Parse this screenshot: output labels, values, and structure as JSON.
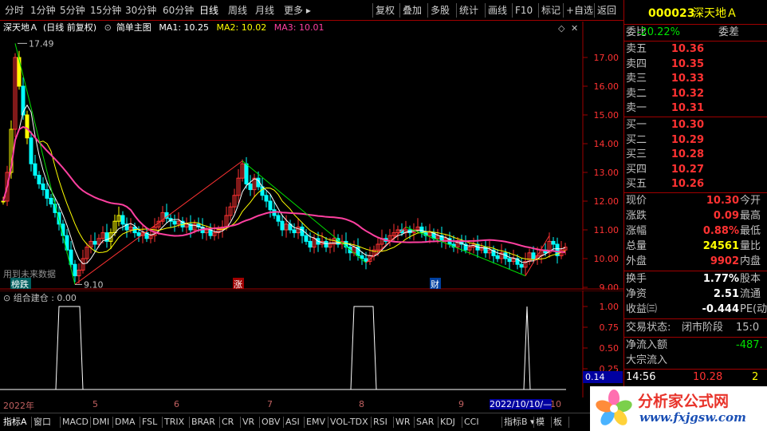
{
  "toolbar": {
    "periods": [
      "分时",
      "1分钟",
      "5分钟",
      "15分钟",
      "30分钟",
      "60分钟",
      "日线",
      "周线",
      "月线",
      "更多"
    ],
    "active_period": "日线",
    "tools": [
      "复权",
      "叠加",
      "多股",
      "统计",
      "画线",
      "F10",
      "标记",
      "+自选",
      "返回"
    ]
  },
  "main": {
    "stock_name": "深天地Ａ",
    "mode": "(日线 前复权)",
    "template_label": "简单主图",
    "ma1_label": "MA1: 10.25",
    "ma2_label": "MA2: 10.02",
    "ma3_label": "MA3: 10.01",
    "high_label": "17.49",
    "low_label": "9.10",
    "future_note": "用到未来数据",
    "event_tags": [
      "榜跌",
      "涨",
      "财"
    ],
    "y_ticks": [
      "17.00",
      "16.00",
      "15.00",
      "14.00",
      "13.00",
      "12.00",
      "11.00",
      "10.00",
      "9.00"
    ]
  },
  "sub": {
    "title": "组合建仓 : 0.00",
    "y_ticks": [
      "1.00",
      "0.75",
      "0.50",
      "0.25"
    ],
    "current_value": "0.14"
  },
  "date_axis": {
    "labels": [
      "2022年",
      "5",
      "6",
      "7",
      "8",
      "9",
      "2022/10/10/—",
      "10"
    ]
  },
  "tabs": [
    "指标A",
    "窗口",
    "MACD",
    "DMI",
    "DMA",
    "FSL",
    "TRIX",
    "BRAR",
    "CR",
    "VR",
    "OBV",
    "ASI",
    "EMV",
    "VOL-TDX",
    "RSI",
    "WR",
    "SAR",
    "KDJ",
    "CCI",
    "指标B",
    "模",
    "板"
  ],
  "panel": {
    "code": "000023",
    "name": "深天地Ａ",
    "weibi_label": "委比",
    "weibi_value": "-20.22%",
    "weicha_label": "委差",
    "sells": [
      {
        "label": "卖五",
        "price": "10.36"
      },
      {
        "label": "卖四",
        "price": "10.35"
      },
      {
        "label": "卖三",
        "price": "10.33"
      },
      {
        "label": "卖二",
        "price": "10.32"
      },
      {
        "label": "卖一",
        "price": "10.31"
      }
    ],
    "buys": [
      {
        "label": "买一",
        "price": "10.30"
      },
      {
        "label": "买二",
        "price": "10.29"
      },
      {
        "label": "买三",
        "price": "10.28"
      },
      {
        "label": "买四",
        "price": "10.27"
      },
      {
        "label": "买五",
        "price": "10.26"
      }
    ],
    "stats": [
      {
        "label": "现价",
        "value": "10.30",
        "label2": "今开",
        "color": "red"
      },
      {
        "label": "涨跌",
        "value": "0.09",
        "label2": "最高",
        "color": "red"
      },
      {
        "label": "涨幅",
        "value": "0.88%",
        "label2": "最低",
        "color": "red"
      },
      {
        "label": "总量",
        "value": "24561",
        "label2": "量比",
        "color": "yellow"
      },
      {
        "label": "外盘",
        "value": "9902",
        "label2": "内盘",
        "color": "red"
      }
    ],
    "stats2": [
      {
        "label": "换手",
        "value": "1.77%",
        "label2": "股本",
        "color": "white"
      },
      {
        "label": "净资",
        "value": "2.51",
        "label2": "流通",
        "color": "white"
      },
      {
        "label": "收益㈢",
        "value": "-0.444",
        "label2": "PE(动)",
        "color": "white"
      }
    ],
    "trade_status_label": "交易状态:",
    "trade_status_value": "闭市阶段",
    "trade_status_time": "15:0",
    "net_inflow_label": "净流入额",
    "net_inflow_value": "-487.",
    "block_inflow_label": "大宗流入",
    "last_tick_time": "14:56",
    "last_tick_price": "10.28",
    "last_tick_vol": "2"
  },
  "logo": {
    "name": "分析家公式网",
    "url": "www.fxjgsw.com"
  },
  "colors": {
    "up": "#ff3232",
    "down": "#00ffff",
    "yellow_bar": "#ffff00",
    "ma1": "#ffffff",
    "ma2": "#ffff00",
    "ma3": "#ff40a0",
    "border": "#a00000",
    "panel_code": "#ffff00"
  }
}
